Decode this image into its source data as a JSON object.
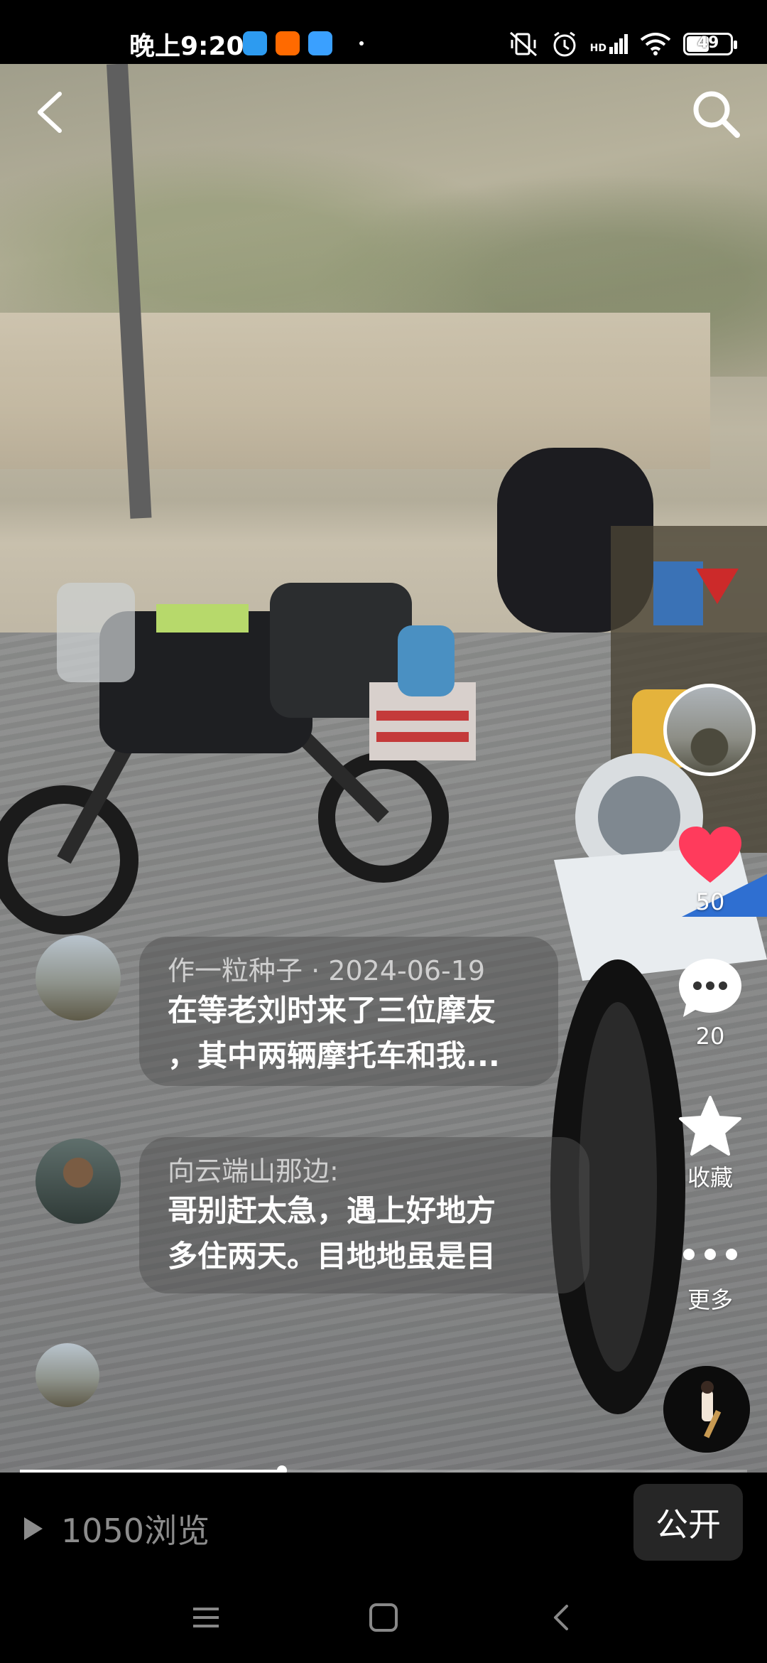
{
  "status_bar": {
    "time": "晚上9:20",
    "battery": "49",
    "network": "HD"
  },
  "post": {
    "comments": [
      {
        "author": "作一粒种子",
        "date": "2024-06-19",
        "text": "在等老刘时来了三位摩友\n，其中两辆摩托车和我..."
      },
      {
        "author": "向云端山那边:",
        "text": "哥别赶太急，遇上好地方\n多住两天。目地地虽是目"
      }
    ],
    "actions": {
      "likes": "50",
      "comments": "20",
      "favorite_label": "收藏",
      "more_label": "更多"
    },
    "progress": 0.36
  },
  "bottom_bar": {
    "views": "1050浏览",
    "visibility_button": "公开"
  },
  "colors": {
    "like": "#ff3b5c",
    "bar_background": "#000000",
    "button_background": "#262626"
  }
}
